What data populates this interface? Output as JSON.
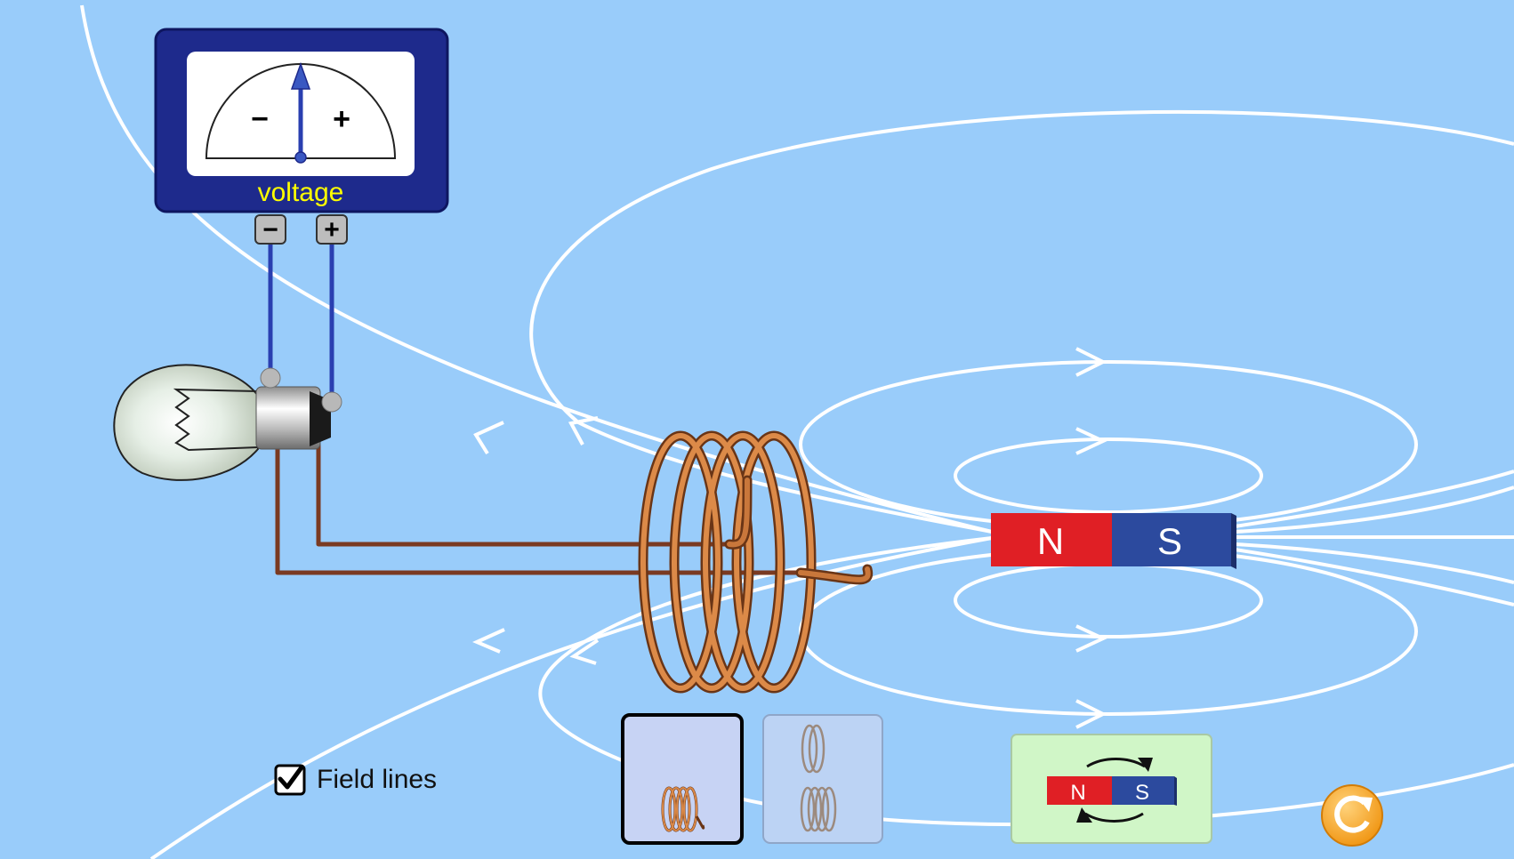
{
  "voltmeter": {
    "title": "voltage",
    "scale_minus": "−",
    "scale_plus": "+",
    "terminal_minus": "−",
    "terminal_plus": "+",
    "reading": 0
  },
  "magnet": {
    "north_label": "N",
    "south_label": "S"
  },
  "controls": {
    "field_lines_label": "Field lines",
    "field_lines_checked": true,
    "coil_options": [
      "one-coil",
      "two-coils"
    ],
    "selected_coil": "one-coil",
    "flip_button": {
      "north_label": "N",
      "south_label": "S"
    }
  },
  "colors": {
    "background": "#99ccfa",
    "field_line": "#ffffff",
    "meter_frame": "#1a237e",
    "meter_title": "#ffff00",
    "magnet_north": "#e01f25",
    "magnet_south": "#2c4a9e",
    "wire_copper": "#d98a4a",
    "reset_orange": "#f5a418"
  }
}
